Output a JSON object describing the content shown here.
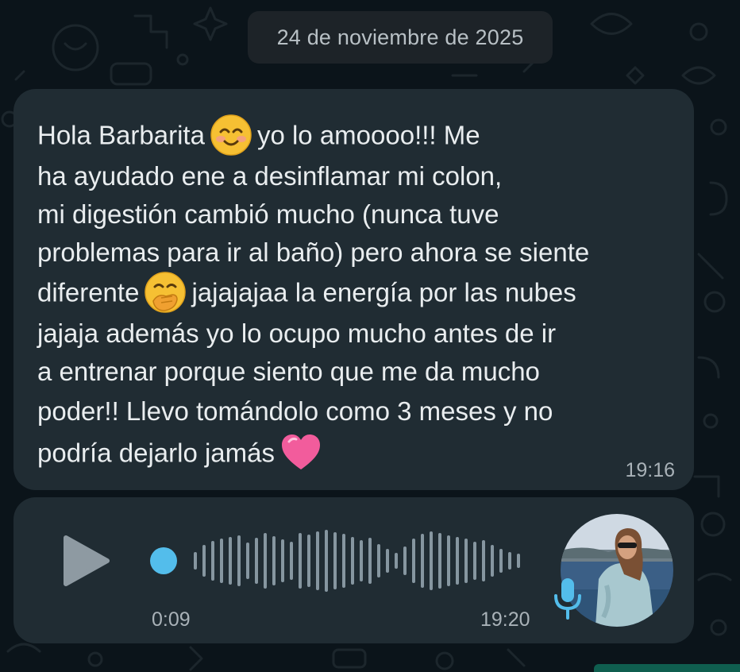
{
  "date_chip": {
    "label": "24 de noviembre de 2025"
  },
  "text_message": {
    "lines": [
      {
        "before": "Hola Barbarita",
        "emoji": "smiling-face-with-smiling-eyes",
        "after": "yo lo amoooo!!! Me"
      },
      {
        "text": "ha ayudado ene a desinflamar mi colon,"
      },
      {
        "text": "mi digestión cambió mucho (nunca tuve"
      },
      {
        "text": "problemas para ir al baño) pero ahora se siente"
      },
      {
        "before": "diferente",
        "emoji": "face-with-hand-over-mouth",
        "after": "jajajajaa la energía por las nubes"
      },
      {
        "text": "jajaja además yo lo ocupo mucho antes de ir"
      },
      {
        "text": "a entrenar porque siento que me da mucho"
      },
      {
        "text": "poder!! Llevo tomándolo como 3 meses y no"
      },
      {
        "before": "podría dejarlo jamás",
        "emoji": "pink-heart",
        "after": ""
      }
    ],
    "time": "19:16"
  },
  "voice_message": {
    "duration": "0:09",
    "time": "19:20",
    "progress": 0,
    "icons": {
      "play": "play-icon",
      "mic": "microphone-icon",
      "avatar": "contact-avatar"
    }
  },
  "colors": {
    "background": "#0b141a",
    "bubble": "#202c33",
    "text": "#e9edef",
    "meta_text": "#a9b2b8",
    "accent_blue": "#53bdeb",
    "waveform": "#8696a0"
  }
}
